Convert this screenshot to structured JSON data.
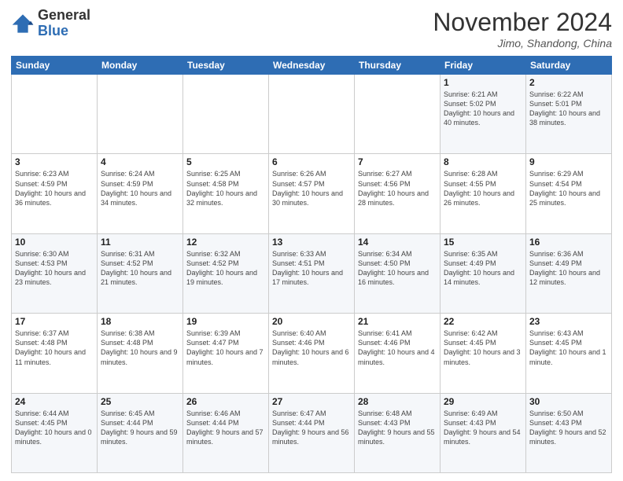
{
  "logo": {
    "general": "General",
    "blue": "Blue"
  },
  "header": {
    "month": "November 2024",
    "location": "Jimo, Shandong, China"
  },
  "days_of_week": [
    "Sunday",
    "Monday",
    "Tuesday",
    "Wednesday",
    "Thursday",
    "Friday",
    "Saturday"
  ],
  "weeks": [
    [
      {
        "day": "",
        "info": ""
      },
      {
        "day": "",
        "info": ""
      },
      {
        "day": "",
        "info": ""
      },
      {
        "day": "",
        "info": ""
      },
      {
        "day": "",
        "info": ""
      },
      {
        "day": "1",
        "info": "Sunrise: 6:21 AM\nSunset: 5:02 PM\nDaylight: 10 hours and 40 minutes."
      },
      {
        "day": "2",
        "info": "Sunrise: 6:22 AM\nSunset: 5:01 PM\nDaylight: 10 hours and 38 minutes."
      }
    ],
    [
      {
        "day": "3",
        "info": "Sunrise: 6:23 AM\nSunset: 4:59 PM\nDaylight: 10 hours and 36 minutes."
      },
      {
        "day": "4",
        "info": "Sunrise: 6:24 AM\nSunset: 4:59 PM\nDaylight: 10 hours and 34 minutes."
      },
      {
        "day": "5",
        "info": "Sunrise: 6:25 AM\nSunset: 4:58 PM\nDaylight: 10 hours and 32 minutes."
      },
      {
        "day": "6",
        "info": "Sunrise: 6:26 AM\nSunset: 4:57 PM\nDaylight: 10 hours and 30 minutes."
      },
      {
        "day": "7",
        "info": "Sunrise: 6:27 AM\nSunset: 4:56 PM\nDaylight: 10 hours and 28 minutes."
      },
      {
        "day": "8",
        "info": "Sunrise: 6:28 AM\nSunset: 4:55 PM\nDaylight: 10 hours and 26 minutes."
      },
      {
        "day": "9",
        "info": "Sunrise: 6:29 AM\nSunset: 4:54 PM\nDaylight: 10 hours and 25 minutes."
      }
    ],
    [
      {
        "day": "10",
        "info": "Sunrise: 6:30 AM\nSunset: 4:53 PM\nDaylight: 10 hours and 23 minutes."
      },
      {
        "day": "11",
        "info": "Sunrise: 6:31 AM\nSunset: 4:52 PM\nDaylight: 10 hours and 21 minutes."
      },
      {
        "day": "12",
        "info": "Sunrise: 6:32 AM\nSunset: 4:52 PM\nDaylight: 10 hours and 19 minutes."
      },
      {
        "day": "13",
        "info": "Sunrise: 6:33 AM\nSunset: 4:51 PM\nDaylight: 10 hours and 17 minutes."
      },
      {
        "day": "14",
        "info": "Sunrise: 6:34 AM\nSunset: 4:50 PM\nDaylight: 10 hours and 16 minutes."
      },
      {
        "day": "15",
        "info": "Sunrise: 6:35 AM\nSunset: 4:49 PM\nDaylight: 10 hours and 14 minutes."
      },
      {
        "day": "16",
        "info": "Sunrise: 6:36 AM\nSunset: 4:49 PM\nDaylight: 10 hours and 12 minutes."
      }
    ],
    [
      {
        "day": "17",
        "info": "Sunrise: 6:37 AM\nSunset: 4:48 PM\nDaylight: 10 hours and 11 minutes."
      },
      {
        "day": "18",
        "info": "Sunrise: 6:38 AM\nSunset: 4:48 PM\nDaylight: 10 hours and 9 minutes."
      },
      {
        "day": "19",
        "info": "Sunrise: 6:39 AM\nSunset: 4:47 PM\nDaylight: 10 hours and 7 minutes."
      },
      {
        "day": "20",
        "info": "Sunrise: 6:40 AM\nSunset: 4:46 PM\nDaylight: 10 hours and 6 minutes."
      },
      {
        "day": "21",
        "info": "Sunrise: 6:41 AM\nSunset: 4:46 PM\nDaylight: 10 hours and 4 minutes."
      },
      {
        "day": "22",
        "info": "Sunrise: 6:42 AM\nSunset: 4:45 PM\nDaylight: 10 hours and 3 minutes."
      },
      {
        "day": "23",
        "info": "Sunrise: 6:43 AM\nSunset: 4:45 PM\nDaylight: 10 hours and 1 minute."
      }
    ],
    [
      {
        "day": "24",
        "info": "Sunrise: 6:44 AM\nSunset: 4:45 PM\nDaylight: 10 hours and 0 minutes."
      },
      {
        "day": "25",
        "info": "Sunrise: 6:45 AM\nSunset: 4:44 PM\nDaylight: 9 hours and 59 minutes."
      },
      {
        "day": "26",
        "info": "Sunrise: 6:46 AM\nSunset: 4:44 PM\nDaylight: 9 hours and 57 minutes."
      },
      {
        "day": "27",
        "info": "Sunrise: 6:47 AM\nSunset: 4:44 PM\nDaylight: 9 hours and 56 minutes."
      },
      {
        "day": "28",
        "info": "Sunrise: 6:48 AM\nSunset: 4:43 PM\nDaylight: 9 hours and 55 minutes."
      },
      {
        "day": "29",
        "info": "Sunrise: 6:49 AM\nSunset: 4:43 PM\nDaylight: 9 hours and 54 minutes."
      },
      {
        "day": "30",
        "info": "Sunrise: 6:50 AM\nSunset: 4:43 PM\nDaylight: 9 hours and 52 minutes."
      }
    ]
  ]
}
